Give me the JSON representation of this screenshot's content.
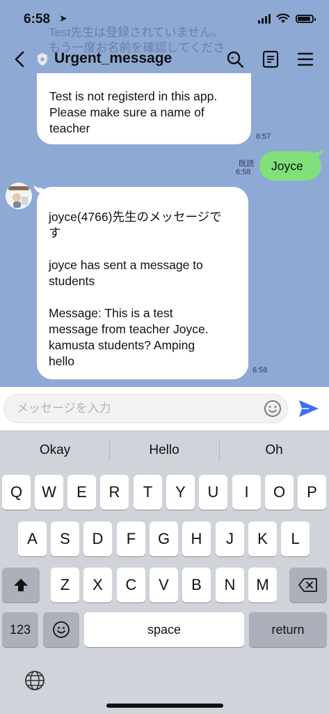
{
  "status": {
    "time": "6:58"
  },
  "ghost": {
    "line1": "Test先生は登録されていません。",
    "line2": "もう一度お名前を確認してくださ"
  },
  "header": {
    "title": "Urgent_message"
  },
  "messages": [
    {
      "text": "Test is not registerd in this app. Please make sure a name of teacher",
      "time": "6:57"
    },
    {
      "text": "Joyce",
      "time": "6:58",
      "read": "既読"
    },
    {
      "line1": "joyce(4766)先生のメッセージで",
      "line2": "す",
      "line3": "joyce has sent a message to",
      "line4": "students",
      "line5": "Message: This is a test",
      "line6": "message from teacher Joyce.",
      "line7": "kamusta students? Amping",
      "line8": "hello",
      "time": "6:58"
    }
  ],
  "input": {
    "placeholder": "メッセージを入力"
  },
  "keyboard": {
    "suggestions": [
      "Okay",
      "Hello",
      "Oh"
    ],
    "row1": [
      "Q",
      "W",
      "E",
      "R",
      "T",
      "Y",
      "U",
      "I",
      "O",
      "P"
    ],
    "row2": [
      "A",
      "S",
      "D",
      "F",
      "G",
      "H",
      "J",
      "K",
      "L"
    ],
    "row3": [
      "Z",
      "X",
      "C",
      "V",
      "B",
      "N",
      "M"
    ],
    "numbers": "123",
    "space": "space",
    "return": "return"
  },
  "colors": {
    "chat_bg": "#8fa9d5",
    "my_bubble": "#80e07a",
    "send": "#3f6ef2"
  }
}
